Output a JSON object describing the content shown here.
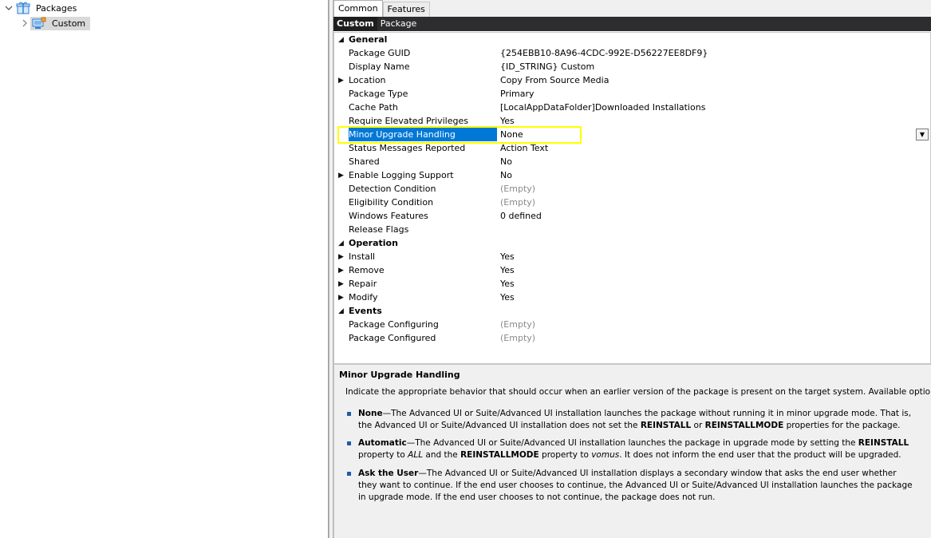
{
  "tree": {
    "root_label": "Packages",
    "child_label": "Custom"
  },
  "tabs": [
    {
      "label": "Common",
      "active": true
    },
    {
      "label": "Features",
      "active": false
    }
  ],
  "header": {
    "items": [
      {
        "label": "Custom",
        "active": true
      },
      {
        "label": "Package",
        "active": false
      }
    ]
  },
  "properties": {
    "general": {
      "label": "General",
      "rows": [
        {
          "name": "Package GUID",
          "value": "{254EBB10-8A96-4CDC-992E-D56227EE8DF9}"
        },
        {
          "name": "Display Name",
          "value": "{ID_STRING} Custom"
        },
        {
          "name": "Location",
          "value": "Copy From Source Media"
        },
        {
          "name": "Package Type",
          "value": "Primary"
        },
        {
          "name": "Cache Path",
          "value": "[LocalAppDataFolder]Downloaded Installations"
        },
        {
          "name": "Require Elevated Privileges",
          "value": "Yes"
        },
        {
          "name": "Minor Upgrade Handling",
          "value": "None"
        },
        {
          "name": "Status Messages Reported",
          "value": "Action Text"
        },
        {
          "name": "Shared",
          "value": "No"
        },
        {
          "name": "Enable Logging Support",
          "value": "No"
        },
        {
          "name": "Detection Condition",
          "value": "(Empty)"
        },
        {
          "name": "Eligibility Condition",
          "value": "(Empty)"
        },
        {
          "name": "Windows Features",
          "value": "0 defined"
        },
        {
          "name": "Release Flags",
          "value": ""
        }
      ]
    },
    "operation": {
      "label": "Operation",
      "rows": [
        {
          "name": "Install",
          "value": "Yes"
        },
        {
          "name": "Remove",
          "value": "Yes"
        },
        {
          "name": "Repair",
          "value": "Yes"
        },
        {
          "name": "Modify",
          "value": "Yes"
        }
      ]
    },
    "events": {
      "label": "Events",
      "rows": [
        {
          "name": "Package Configuring",
          "value": "(Empty)"
        },
        {
          "name": "Package Configured",
          "value": "(Empty)"
        }
      ]
    }
  },
  "description": {
    "title": "Minor Upgrade Handling",
    "intro": "Indicate the appropriate behavior that should occur when an earlier version of the package is present on the target system. Available options are:",
    "bullets": [
      {
        "term": "None",
        "parts": [
          {
            "t": "—The Advanced UI or Suite/Advanced UI installation launches the package without running it in minor upgrade mode. That is, the Advanced UI or Suite/Advanced UI installation does not set the ",
            "s": ""
          },
          {
            "t": "REINSTALL",
            "s": "b"
          },
          {
            "t": " or ",
            "s": ""
          },
          {
            "t": "REINSTALLMODE",
            "s": "b"
          },
          {
            "t": " properties for the package.",
            "s": ""
          }
        ]
      },
      {
        "term": "Automatic",
        "parts": [
          {
            "t": "—The Advanced UI or Suite/Advanced UI installation launches the package in upgrade mode by setting the ",
            "s": ""
          },
          {
            "t": "REINSTALL",
            "s": "b"
          },
          {
            "t": " property to ",
            "s": ""
          },
          {
            "t": "ALL",
            "s": "i"
          },
          {
            "t": " and the ",
            "s": ""
          },
          {
            "t": "REINSTALLMODE",
            "s": "b"
          },
          {
            "t": " property to ",
            "s": ""
          },
          {
            "t": "vomus",
            "s": "i"
          },
          {
            "t": ". It does not inform the end user that the product will be upgraded.",
            "s": ""
          }
        ]
      },
      {
        "term": "Ask the User",
        "parts": [
          {
            "t": "—The Advanced UI or Suite/Advanced UI installation displays a secondary window that asks the end user whether they want to continue. If the end user chooses to continue, the Advanced UI or Suite/Advanced UI installation launches the package in upgrade mode. If the end user chooses to not continue, the package does not run.",
            "s": ""
          }
        ]
      }
    ]
  },
  "colors": {
    "selection": "#0078d7",
    "highlight_box": "#ffff00",
    "header_bar": "#2d2d30",
    "bullet": "#1e5ca8"
  }
}
